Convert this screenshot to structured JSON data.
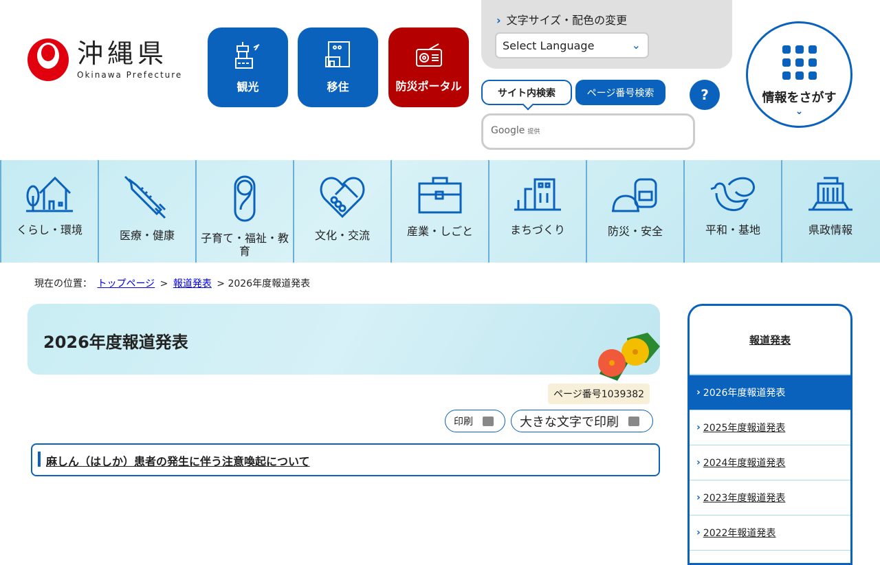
{
  "header": {
    "logo_jp": "沖縄県",
    "logo_en": "Okinawa Prefecture",
    "quick": [
      {
        "label": "観光",
        "icon": "airport-tower-icon"
      },
      {
        "label": "移住",
        "icon": "house-building-icon"
      },
      {
        "label": "防災ポータル",
        "icon": "radio-icon"
      }
    ],
    "font_color_label": "文字サイズ・配色の変更",
    "language_select": "Select Language",
    "search_tabs": [
      "サイト内検索",
      "ページ番号検索"
    ],
    "help": "?",
    "search_provider": "Google",
    "search_provider_suffix": "提供",
    "find_info": "情報をさがす"
  },
  "nav": [
    {
      "label": "くらし・環境",
      "icon": "house-icon"
    },
    {
      "label": "医療・健康",
      "icon": "syringe-icon"
    },
    {
      "label": "子育て・福祉・教育",
      "icon": "baby-icon"
    },
    {
      "label": "文化・交流",
      "icon": "handshake-heart-icon"
    },
    {
      "label": "産業・しごと",
      "icon": "briefcase-icon"
    },
    {
      "label": "まちづくり",
      "icon": "buildings-icon"
    },
    {
      "label": "防災・安全",
      "icon": "helmet-backpack-icon"
    },
    {
      "label": "平和・基地",
      "icon": "dove-icon"
    },
    {
      "label": "県政情報",
      "icon": "government-building-icon"
    }
  ],
  "breadcrumb": {
    "label": "現在の位置：",
    "links": [
      "トップページ",
      "報道発表"
    ],
    "current": "2026年度報道発表"
  },
  "main": {
    "title": "2026年度報道発表",
    "page_number": "ページ番号1039382",
    "print": "印刷",
    "print_large": "大きな文字で印刷",
    "articles": [
      "麻しん（はしか）患者の発生に伴う注意喚起について"
    ]
  },
  "sidebar": {
    "title": "報道発表",
    "items": [
      "2026年度報道発表",
      "2025年度報道発表",
      "2024年度報道発表",
      "2023年度報道発表",
      "2022年報道発表"
    ],
    "active": 0
  },
  "colors": {
    "primary": "#0a62bd",
    "disaster": "#b50000",
    "logo_red": "#e0000e"
  }
}
